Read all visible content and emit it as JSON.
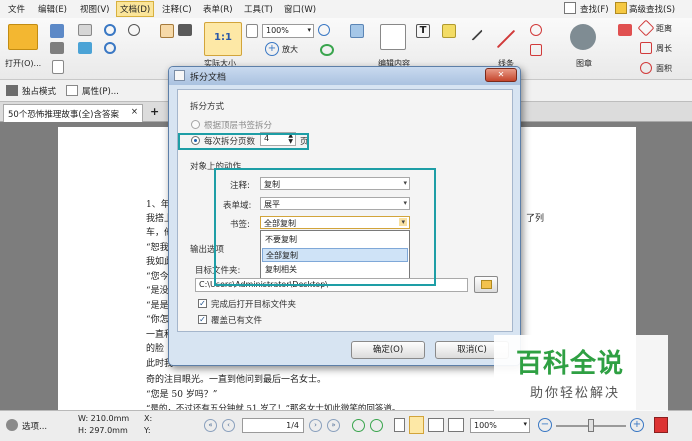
{
  "menu": {
    "items": [
      "文件",
      "编辑(E)",
      "视图(V)",
      "文档(D)",
      "注释(C)",
      "表单(R)",
      "工具(T)",
      "窗口(W)"
    ],
    "active_index": 3,
    "right_find": "查找(F)",
    "right_advanced_find": "高级查找(S)"
  },
  "toolbar": {
    "open_label": "打开(O)...",
    "zoom_value": "100%",
    "zoom_in_label": "放大",
    "actual_size_label": "1:1",
    "actual_size_caption": "实际大小",
    "edit_content_label": "编辑内容",
    "line_label": "线条",
    "stamp_label": "图章",
    "distance_label": "距离",
    "perimeter_label": "周长",
    "area_label": "面积"
  },
  "toolbar2": {
    "standalone_mode": "独占模式",
    "properties": "属性(P)..."
  },
  "tab": {
    "title": "50个恐怖推理故事(全)含答案",
    "close": "×",
    "add": "+"
  },
  "document": {
    "lines": [
      "1、年",
      "我搭上",
      "车，他",
      "“恕我",
      "我如此",
      "“您今",
      "“是没",
      "“是是",
      "“你怎",
      "一直和",
      "的脸",
      "此时我",
      "奇的注目眼光。一直到他问到最后一名女士。",
      "“您是 50 岁吗？”",
      "“是的，不过还有五分钟就 51 岁了！”那名女士如此微笑的回答道。"
    ],
    "right_fragment": "了列"
  },
  "dialog": {
    "title": "拆分文档",
    "close": "✕",
    "split_method_label": "拆分方式",
    "option_bookmarks": "根据顶层书签拆分",
    "option_pages": "每次拆分页数",
    "pages_value": "4",
    "pages_unit": "页",
    "object_actions_label": "对象上的动作",
    "annotations_label": "注释:",
    "annotations_value": "复制",
    "form_fields_label": "表单域:",
    "form_fields_value": "展平",
    "bookmarks_label": "书签:",
    "bookmarks_value": "全部复制",
    "bookmark_options": [
      "不要复制",
      "全部复制",
      "复制相关"
    ],
    "bookmark_selected_index": 1,
    "output_label": "输出选项",
    "target_folder_label": "目标文件夹:",
    "target_folder_value": "C:\\Users\\Administrator\\Desktop\\",
    "open_folder_label": "完成后打开目标文件夹",
    "overwrite_label": "覆盖已有文件",
    "ok_label": "确定(O)",
    "cancel_label": "取消(C)"
  },
  "statusbar": {
    "options": "选项...",
    "width": "W: 210.0mm",
    "height": "H: 297.0mm",
    "x": "X:",
    "y": "Y:",
    "page_indicator": "1/4",
    "zoom": "100%"
  },
  "watermark": {
    "title": "百科全说",
    "subtitle": "助你轻松解决"
  },
  "colors": {
    "highlight_box": "#1e9ea6",
    "watermark_green": "#2fa043",
    "active_menu": "#fbe59a",
    "dialog_frame": "#d7e4f2"
  }
}
